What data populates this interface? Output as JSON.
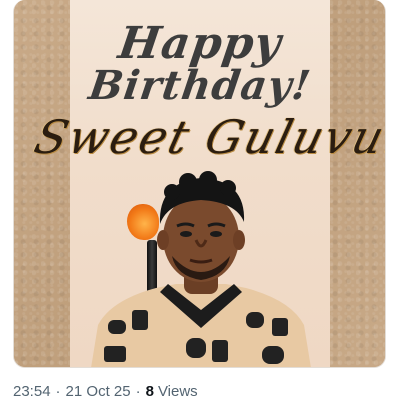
{
  "post": {
    "image": {
      "greeting_line1": "Happy",
      "greeting_line2": "Birthday!",
      "name_line": "Sweet Guluvu."
    },
    "meta": {
      "time": "23:54",
      "date": "21 Oct 25",
      "views_count": "8",
      "views_label": "Views",
      "separator": "·"
    }
  },
  "colors": {
    "kraft_background": "#c6a785",
    "card_background": "#f2dfcd",
    "greeting_text": "#3d3d3d",
    "meta_text": "#536471",
    "views_count_text": "#0f1419"
  }
}
